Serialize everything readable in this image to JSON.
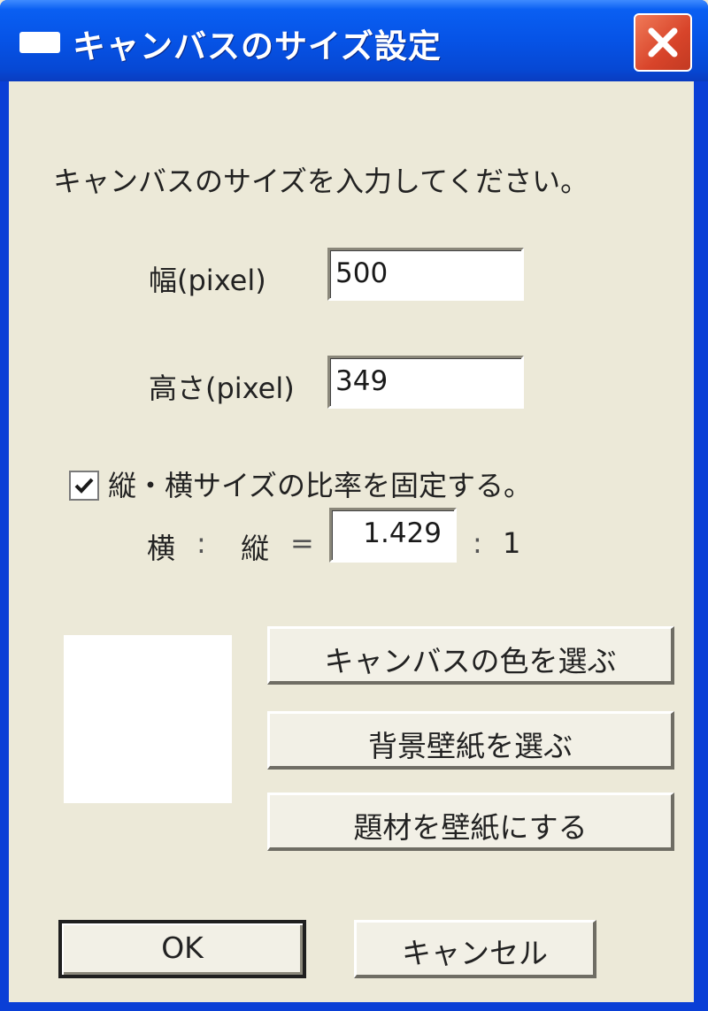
{
  "window": {
    "title": "キャンバスのサイズ設定",
    "close_label": "✕"
  },
  "prompt": "キャンバスのサイズを入力してください。",
  "width_field": {
    "label": "幅(pixel)",
    "value": "500"
  },
  "height_field": {
    "label": "高さ(pixel)",
    "value": "349"
  },
  "aspect_lock": {
    "label": "縦・横サイズの比率を固定する。",
    "checked": true
  },
  "ratio": {
    "label_horizontal": "横",
    "sep1": ":",
    "label_vertical": "縦",
    "equals": "=",
    "value": "1.429",
    "sep2": ":",
    "right": "1"
  },
  "canvas_color_preview": "#ffffff",
  "buttons": {
    "choose_canvas_color": "キャンバスの色を選ぶ",
    "choose_background_wallpaper": "背景壁紙を選ぶ",
    "use_material_as_wallpaper": "題材を壁紙にする",
    "ok": "OK",
    "cancel": "キャンセル"
  }
}
